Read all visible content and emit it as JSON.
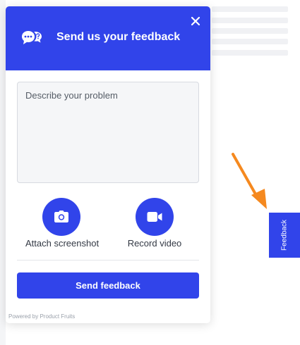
{
  "widget": {
    "title": "Send us your feedback",
    "close_icon": "close-icon",
    "header_icon": "chat-bubbles-icon",
    "textarea_placeholder": "Describe your problem",
    "textarea_value": "",
    "actions": [
      {
        "label": "Attach screenshot",
        "icon": "camera-icon"
      },
      {
        "label": "Record video",
        "icon": "video-camera-icon"
      }
    ],
    "submit_label": "Send feedback",
    "powered_by": "Powered by Product Fruits"
  },
  "feedback_tab": {
    "label": "Feedback"
  },
  "colors": {
    "accent": "#3144ea",
    "arrow": "#f5891f",
    "text": "#333944"
  }
}
